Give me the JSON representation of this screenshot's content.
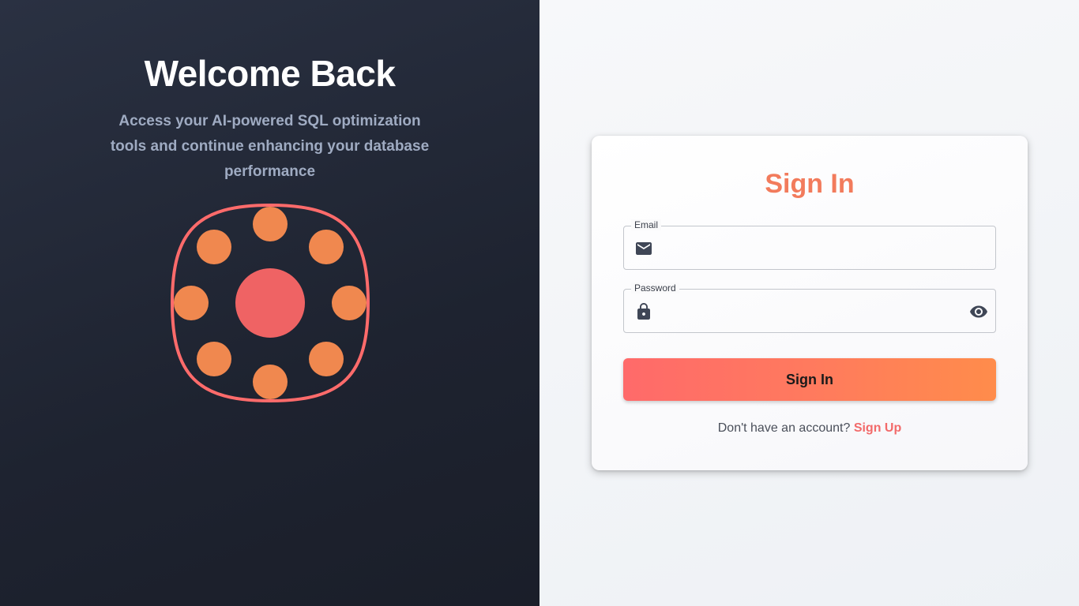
{
  "hero": {
    "title": "Welcome Back",
    "subtitle": "Access your AI-powered SQL optimization tools and continue enhancing your database performance"
  },
  "form": {
    "title": "Sign In",
    "email_label": "Email",
    "email_value": "",
    "password_label": "Password",
    "password_value": "",
    "submit_label": "Sign In",
    "signup_prompt": "Don't have an account?",
    "signup_link": "Sign Up"
  },
  "icons": {
    "email": "mail-icon",
    "password": "lock-icon",
    "visibility": "eye-icon"
  },
  "colors": {
    "accent": "#f27b5c",
    "button_start": "#ff6a6a",
    "button_end": "#ff8c4b",
    "dark_panel": "#1e2330",
    "illustration_outline": "#ff6b6b",
    "illustration_dots": "#f0884f",
    "illustration_center": "#ef6364"
  }
}
